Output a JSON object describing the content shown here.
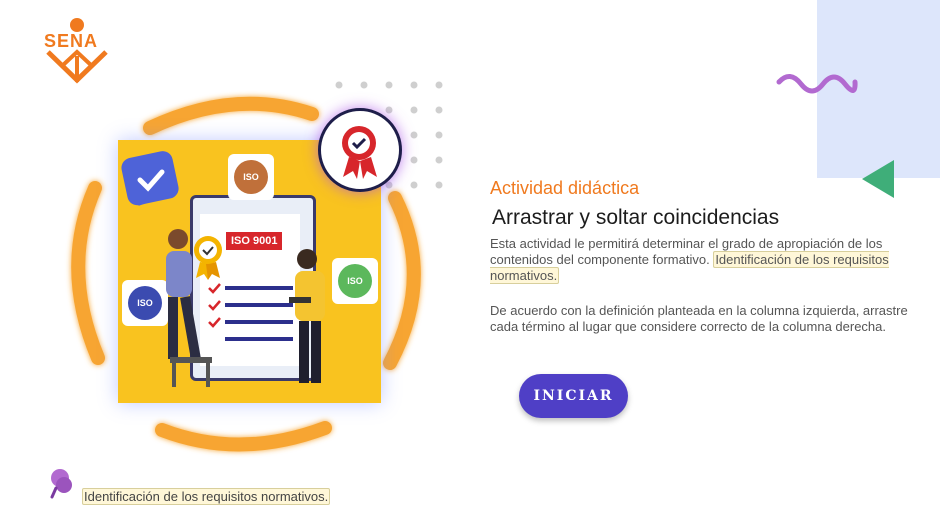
{
  "brand": {
    "logo_text": "SENA",
    "accent": "#f07a1f",
    "purple": "#4f3fc6"
  },
  "illustration": {
    "iso_label": "ISO 9001",
    "badge_text": "ISO",
    "icons": [
      "check-chat-icon",
      "award-ribbon-icon",
      "iso-seal-icon"
    ]
  },
  "content": {
    "kicker": "Actividad didáctica",
    "title": "Arrastrar y soltar coincidencias",
    "paragraph1_before": "Esta actividad le permitirá determinar el grado de apropiación de los contenidos del componente formativo. ",
    "paragraph1_highlight": "Identificación de los requisitos normativos.",
    "paragraph2": "De acuerdo con la definición planteada en la columna izquierda, arrastre cada término al lugar que considere correcto de la columna derecha."
  },
  "actions": {
    "start_label": "INICIAR"
  },
  "footer": {
    "topic_label": "Identificación de los requisitos normativos."
  }
}
